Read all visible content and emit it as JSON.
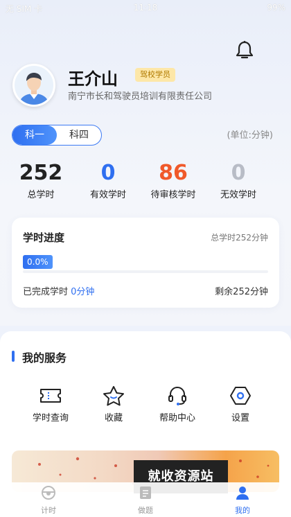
{
  "status_bar": {
    "carrier": "无 SIM 卡",
    "time": "11:18",
    "battery": "99%"
  },
  "profile": {
    "name": "王介山",
    "badge": "驾校学员",
    "company": "南宁市长和驾驶员培训有限责任公司"
  },
  "subject_tabs": {
    "items": [
      "科一",
      "科四"
    ],
    "active": "科一"
  },
  "unit_label": "(单位:分钟)",
  "stats": [
    {
      "value": "252",
      "label": "总学时",
      "color": "#222222"
    },
    {
      "value": "0",
      "label": "有效学时",
      "color": "#2f6ff0"
    },
    {
      "value": "86",
      "label": "待审核学时",
      "color": "#f0592a"
    },
    {
      "value": "0",
      "label": "无效学时",
      "color": "#b8bcc6"
    }
  ],
  "progress_card": {
    "title": "学时进度",
    "total": "总学时252分钟",
    "percent_label": "0.0%",
    "percent": 0,
    "done_label": "已完成学时",
    "done_value": "0分钟",
    "remaining": "剩余252分钟"
  },
  "services": {
    "title": "我的服务",
    "items": [
      {
        "label": "学时查询",
        "icon": "ticket-icon"
      },
      {
        "label": "收藏",
        "icon": "star-icon"
      },
      {
        "label": "帮助中心",
        "icon": "headset-icon"
      },
      {
        "label": "设置",
        "icon": "hexagon-settings-icon"
      }
    ]
  },
  "watermark": "就收资源站",
  "tabbar": {
    "items": [
      {
        "label": "计时",
        "icon": "steering-wheel-icon"
      },
      {
        "label": "做题",
        "icon": "exam-icon"
      },
      {
        "label": "我的",
        "icon": "user-icon"
      }
    ],
    "active": "我的"
  },
  "colors": {
    "accent": "#2f6ff0",
    "pending": "#f0592a"
  }
}
